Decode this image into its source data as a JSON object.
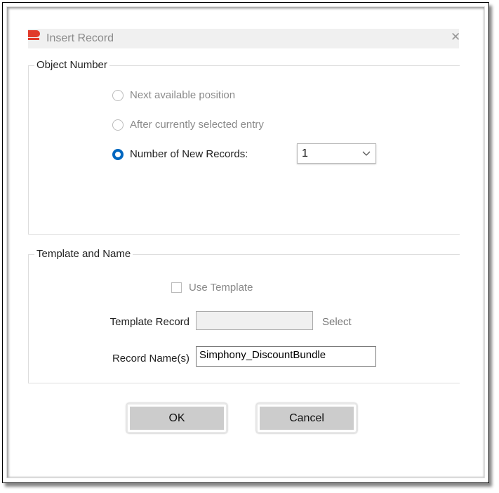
{
  "dialog": {
    "title": "Insert Record",
    "close_icon": "close-icon"
  },
  "object_number": {
    "label": "Object Number",
    "options": [
      {
        "label": "Next available position",
        "selected": false,
        "enabled": false
      },
      {
        "label": "After currently selected entry",
        "selected": false,
        "enabled": false
      },
      {
        "label": "Number of New Records:",
        "selected": true,
        "enabled": true
      }
    ],
    "count_value": "1"
  },
  "template_and_name": {
    "label": "Template and Name",
    "use_template_label": "Use Template",
    "use_template_checked": false,
    "template_record_label": "Template Record",
    "template_record_value": "",
    "select_label": "Select",
    "record_names_label": "Record Name(s)",
    "record_names_value": "Simphony_DiscountBundle"
  },
  "buttons": {
    "ok": "OK",
    "cancel": "Cancel"
  },
  "colors": {
    "accent": "#0067c0",
    "logo": "#e03a2b"
  }
}
